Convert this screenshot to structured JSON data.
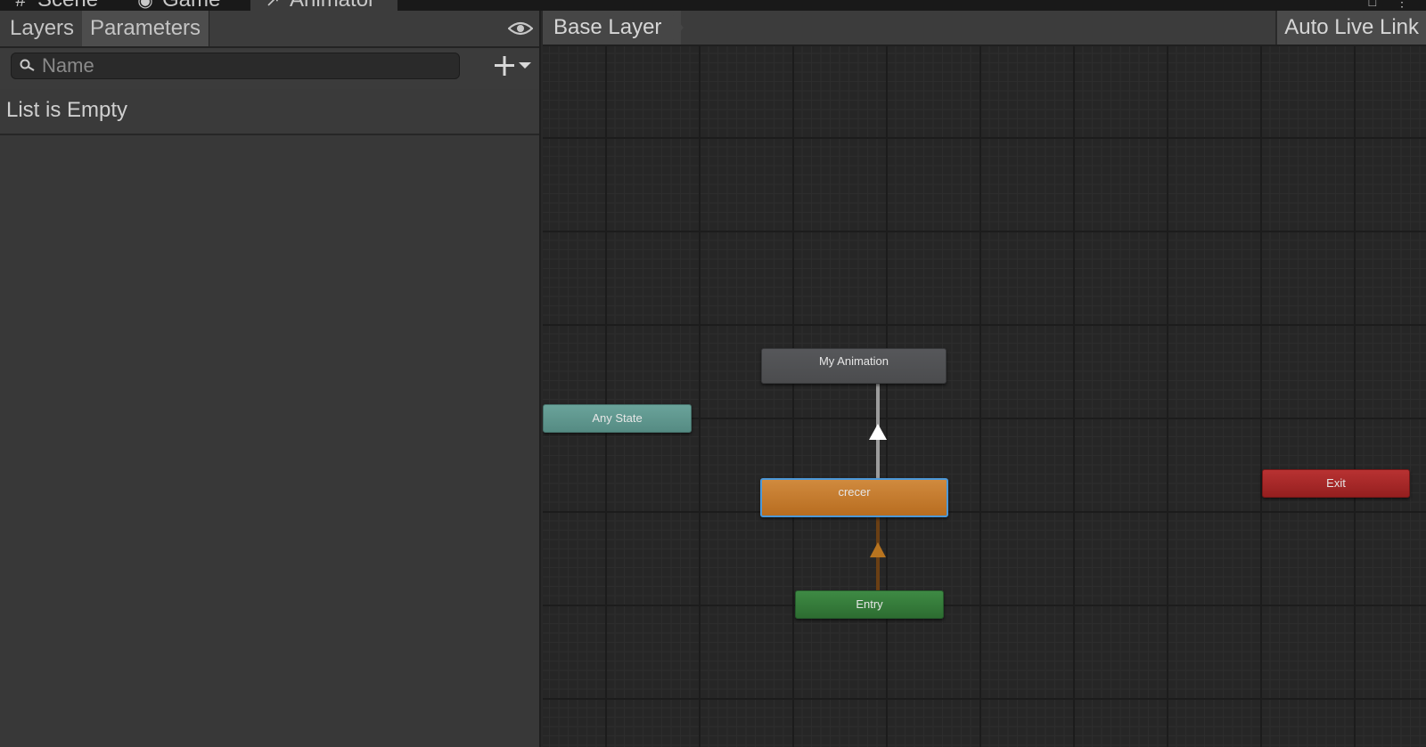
{
  "window_tabs": [
    {
      "label": "Scene",
      "icon": "hash-icon"
    },
    {
      "label": "Game",
      "icon": "gamepad-icon"
    },
    {
      "label": "Animator",
      "icon": "animator-icon"
    }
  ],
  "left_panel": {
    "tabs": [
      {
        "label": "Layers",
        "selected": false
      },
      {
        "label": "Parameters",
        "selected": true
      }
    ],
    "search": {
      "placeholder": "Name",
      "value": ""
    },
    "empty_message": "List is Empty"
  },
  "graph": {
    "breadcrumb": "Base Layer",
    "live_link_label": "Auto Live Link",
    "states": {
      "my_animation": "My Animation",
      "any_state": "Any State",
      "crecer": "crecer",
      "entry": "Entry",
      "exit": "Exit"
    }
  },
  "colors": {
    "any_state": "#5e968d",
    "crecer": "#c47a2e",
    "crecer_selected_border": "#4c98d8",
    "entry": "#357b3a",
    "exit": "#a72828",
    "default_state": "#505154"
  }
}
